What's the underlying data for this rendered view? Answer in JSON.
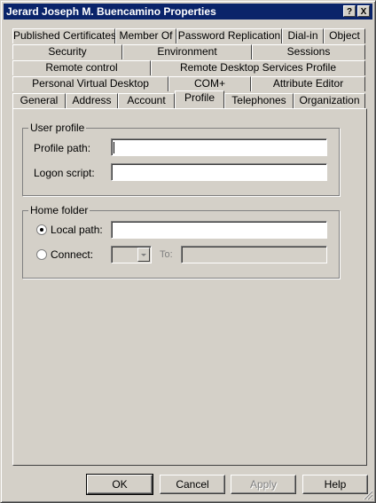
{
  "window": {
    "title": "Jerard Joseph M. Buencamino Properties",
    "help_label": "?",
    "close_label": "X"
  },
  "tabs": {
    "row1": [
      "Published Certificates",
      "Member Of",
      "Password Replication",
      "Dial-in",
      "Object"
    ],
    "row2": [
      "Security",
      "Environment",
      "Sessions"
    ],
    "row3": [
      "Remote control",
      "Remote Desktop Services Profile"
    ],
    "row4": [
      "Personal Virtual Desktop",
      "COM+",
      "Attribute Editor"
    ],
    "row5": [
      "General",
      "Address",
      "Account",
      "Profile",
      "Telephones",
      "Organization"
    ],
    "active": "Profile"
  },
  "user_profile": {
    "legend": "User profile",
    "profile_path_label": "Profile path:",
    "profile_path_value": "",
    "logon_script_label": "Logon script:",
    "logon_script_value": ""
  },
  "home_folder": {
    "legend": "Home folder",
    "local_path_label": "Local path:",
    "local_path_value": "",
    "local_path_selected": true,
    "connect_label": "Connect:",
    "connect_drive_value": "",
    "to_label": "To:",
    "to_value": ""
  },
  "buttons": {
    "ok": "OK",
    "cancel": "Cancel",
    "apply": "Apply",
    "help": "Help"
  }
}
